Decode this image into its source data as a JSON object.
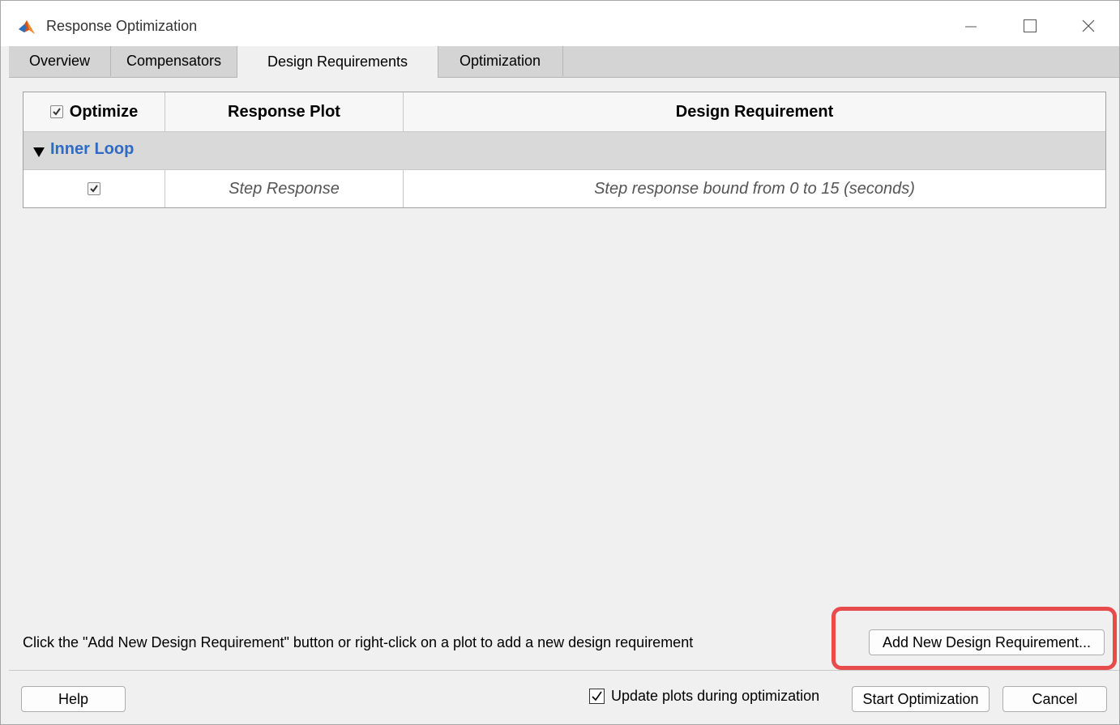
{
  "window": {
    "title": "Response Optimization",
    "controls": [
      "minimize",
      "maximize",
      "close"
    ]
  },
  "tabs": [
    {
      "label": "Overview",
      "active": false
    },
    {
      "label": "Compensators",
      "active": false
    },
    {
      "label": "Design Requirements",
      "active": true
    },
    {
      "label": "Optimization",
      "active": false
    }
  ],
  "table": {
    "headers": {
      "optimize": "Optimize",
      "response_plot": "Response Plot",
      "design_requirement": "Design Requirement"
    },
    "optimize_all_checked": true,
    "group": {
      "label": "Inner Loop",
      "expanded": true
    },
    "rows": [
      {
        "optimize": true,
        "response_plot": "Step Response",
        "design_requirement": "Step response bound from 0 to 15 (seconds)"
      }
    ]
  },
  "hint": "Click the \"Add New Design Requirement\" button or right-click on a plot to add a new design requirement",
  "buttons": {
    "add_requirement": "Add New Design Requirement...",
    "help": "Help",
    "start": "Start Optimization",
    "cancel": "Cancel"
  },
  "update_plots": {
    "label": "Update plots during optimization",
    "checked": true
  },
  "colors": {
    "group_label": "#2d6bc4",
    "highlight": "#e84b4b"
  }
}
